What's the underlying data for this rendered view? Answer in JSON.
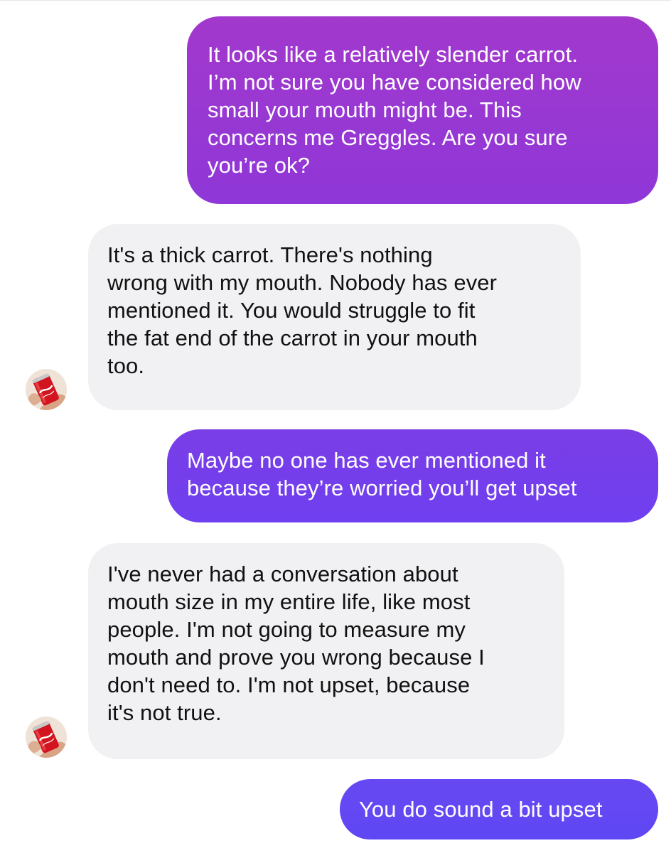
{
  "conversation": {
    "messages": [
      {
        "direction": "sent",
        "text": "It looks like a relatively slender carrot.\nI’m not sure you have considered how\nsmall your mouth might be. This\nconcerns me Greggles. Are you sure\nyou’re ok?"
      },
      {
        "direction": "received",
        "text": "It's a thick carrot. There's nothing\nwrong with my mouth. Nobody has ever\nmentioned it. You would struggle to fit\nthe fat end of the carrot in your mouth\ntoo."
      },
      {
        "direction": "sent",
        "text": "Maybe no one has ever mentioned it\nbecause they’re worried you’ll get upset"
      },
      {
        "direction": "received",
        "text": "I've never had a conversation about\nmouth size in my entire life, like most\npeople. I'm not going to measure my\nmouth and prove you wrong because I\ndon't need to. I'm not upset, because\nit's not true."
      },
      {
        "direction": "sent",
        "text": "You do sound a bit upset"
      }
    ]
  },
  "avatar": {
    "icon": "coca-cola-can-icon",
    "can_label": "Coca-Cola"
  },
  "colors": {
    "sent_gradient_top": "#a238cc",
    "sent_gradient_mid": "#7a3ee6",
    "sent_gradient_bottom": "#5f47f4",
    "received_bubble": "#f1f1f3",
    "received_text": "#111111",
    "sent_text": "#ffffff"
  }
}
